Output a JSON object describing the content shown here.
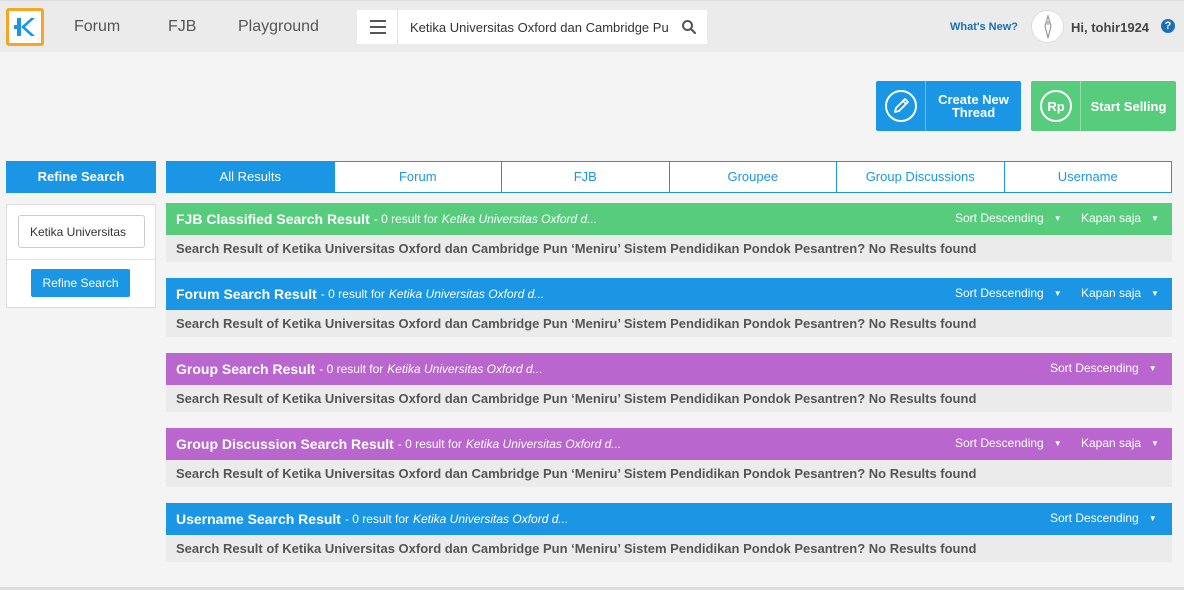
{
  "header": {
    "logo_letter": "K",
    "nav": [
      "Forum",
      "FJB",
      "Playground"
    ],
    "search_value": "Ketika Universitas Oxford dan Cambridge Pun",
    "whats_new": "What's New?",
    "greeting": "Hi, tohir1924",
    "help": "?"
  },
  "actions": {
    "create_line1": "Create New",
    "create_line2": "Thread",
    "sell_label": "Start Selling",
    "sell_icon_text": "Rp"
  },
  "sidebar": {
    "title": "Refine Search",
    "input_value": "Ketika Universitas",
    "button": "Refine Search"
  },
  "tabs": [
    "All Results",
    "Forum",
    "FJB",
    "Groupee",
    "Group Discussions",
    "Username"
  ],
  "results": [
    {
      "title": "FJB Classified Search Result",
      "meta": "- 0 result for",
      "query": "Ketika Universitas Oxford d...",
      "sort": "Sort Descending",
      "time": "Kapan saja",
      "color": "#57cc7d",
      "body": "Search Result of Ketika Universitas Oxford dan Cambridge Pun ‘Meniru’ Sistem Pendidikan Pondok Pesantren? No Results found"
    },
    {
      "title": "Forum Search Result",
      "meta": "- 0 result for",
      "query": "Ketika Universitas Oxford d...",
      "sort": "Sort Descending",
      "time": "Kapan saja",
      "color": "#1a96e5",
      "body": "Search Result of Ketika Universitas Oxford dan Cambridge Pun ‘Meniru’ Sistem Pendidikan Pondok Pesantren? No Results found"
    },
    {
      "title": "Group Search Result",
      "meta": "- 0 result for",
      "query": "Ketika Universitas Oxford d...",
      "sort": "Sort Descending",
      "color": "#b966cf",
      "body": "Search Result of Ketika Universitas Oxford dan Cambridge Pun ‘Meniru’ Sistem Pendidikan Pondok Pesantren? No Results found"
    },
    {
      "title": "Group Discussion Search Result",
      "meta": "- 0 result for",
      "query": "Ketika Universitas Oxford d...",
      "sort": "Sort Descending",
      "time": "Kapan saja",
      "color": "#b966cf",
      "body": "Search Result of Ketika Universitas Oxford dan Cambridge Pun ‘Meniru’ Sistem Pendidikan Pondok Pesantren? No Results found"
    },
    {
      "title": "Username Search Result",
      "meta": "- 0 result for",
      "query": "Ketika Universitas Oxford d...",
      "sort": "Sort Descending",
      "color": "#1a96e5",
      "body": "Search Result of Ketika Universitas Oxford dan Cambridge Pun ‘Meniru’ Sistem Pendidikan Pondok Pesantren? No Results found"
    }
  ],
  "colors": {
    "accent_blue": "#1a96e5",
    "green": "#57cc7d",
    "purple": "#b966cf",
    "logo_orange": "#f7a623"
  }
}
